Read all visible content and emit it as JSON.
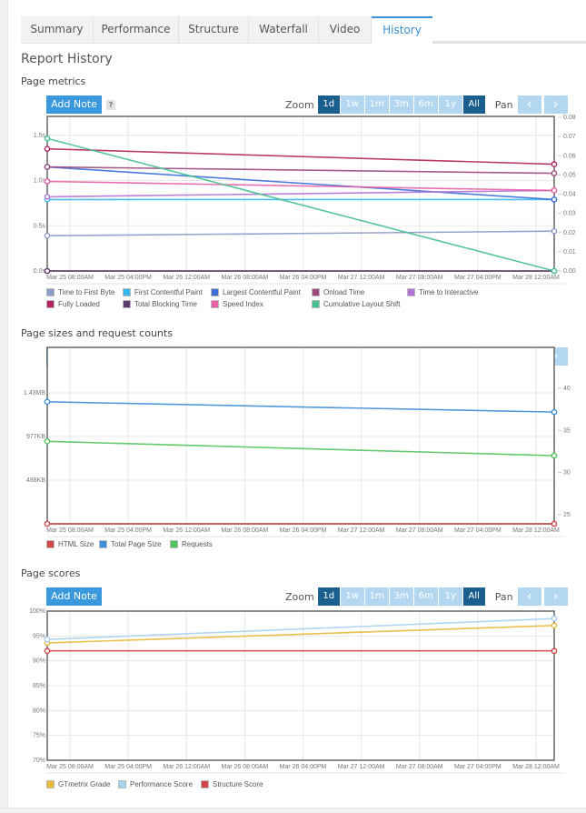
{
  "tabs": [
    {
      "label": "Summary",
      "active": false
    },
    {
      "label": "Performance",
      "active": false
    },
    {
      "label": "Structure",
      "active": false
    },
    {
      "label": "Waterfall",
      "active": false
    },
    {
      "label": "Video",
      "active": false
    },
    {
      "label": "History",
      "active": true
    }
  ],
  "page_title": "Report History",
  "controls": {
    "add_note_label": "Add Note",
    "help_label": "?",
    "zoom_label": "Zoom",
    "zoom_options": [
      {
        "label": "1d",
        "selected": true
      },
      {
        "label": "1w",
        "selected": false
      },
      {
        "label": "1m",
        "selected": false
      },
      {
        "label": "3m",
        "selected": false
      },
      {
        "label": "6m",
        "selected": false
      },
      {
        "label": "1y",
        "selected": false
      },
      {
        "label": "All",
        "selected": true
      }
    ],
    "pan_label": "Pan",
    "pan_prev_icon": "‹",
    "pan_next_icon": "›"
  },
  "chart_data": [
    {
      "type": "line",
      "title": "Page metrics",
      "x": [
        "Mar 25 08:00AM",
        "Mar 25 04:00PM",
        "Mar 26 12:00AM",
        "Mar 26 08:00AM",
        "Mar 26 04:00PM",
        "Mar 27 12:00AM",
        "Mar 27 08:00AM",
        "Mar 27 04:00PM",
        "Mar 28 12:00AM"
      ],
      "x_start_label": "Mar 25 08:00AM",
      "x_end_label": "Mar 28 12:00AM",
      "left_axis": {
        "ticks": [
          "0.0s",
          "0.5s",
          "1.0s",
          "1.5s"
        ],
        "tick_values": [
          0,
          0.5,
          1.0,
          1.5
        ],
        "range": [
          0,
          1.71
        ]
      },
      "right_axis": {
        "ticks": [
          "0.00",
          "0.01",
          "0.02",
          "0.03",
          "0.04",
          "0.05",
          "0.06",
          "0.07",
          "0.08"
        ],
        "tick_values": [
          0,
          0.01,
          0.02,
          0.03,
          0.04,
          0.05,
          0.06,
          0.07,
          0.08
        ],
        "range": [
          0,
          0.08
        ]
      },
      "grid": true,
      "legend_position": "bottom",
      "series": [
        {
          "name": "Time to First Byte",
          "color": "#8b9bc9",
          "axis": "left",
          "values": [
            0.39,
            0.44
          ]
        },
        {
          "name": "First Contentful Paint",
          "color": "#36b6ea",
          "axis": "left",
          "values": [
            0.79,
            0.79
          ]
        },
        {
          "name": "Largest Contentful Paint",
          "color": "#3a6fd8",
          "axis": "left",
          "values": [
            1.15,
            0.79
          ]
        },
        {
          "name": "Onload Time",
          "color": "#9b4a7e",
          "axis": "left",
          "values": [
            1.15,
            1.08
          ]
        },
        {
          "name": "Time to Interactive",
          "color": "#b172d6",
          "axis": "left",
          "values": [
            0.82,
            0.89
          ]
        },
        {
          "name": "Fully Loaded",
          "color": "#b2245f",
          "axis": "left",
          "values": [
            1.35,
            1.18
          ]
        },
        {
          "name": "Total Blocking Time",
          "color": "#5b3a6e",
          "axis": "left",
          "values": [
            0.0,
            0.0
          ]
        },
        {
          "name": "Speed Index",
          "color": "#e85fa5",
          "axis": "left",
          "values": [
            0.99,
            0.89
          ]
        },
        {
          "name": "Cumulative Layout Shift",
          "color": "#45c090",
          "axis": "right",
          "values": [
            0.069,
            0.0
          ]
        }
      ]
    },
    {
      "type": "line",
      "title": "Page sizes and request counts",
      "x": [
        "Mar 25 08:00AM",
        "Mar 25 04:00PM",
        "Mar 26 12:00AM",
        "Mar 26 08:00AM",
        "Mar 26 04:00PM",
        "Mar 27 12:00AM",
        "Mar 27 08:00AM",
        "Mar 27 04:00PM",
        "Mar 28 12:00AM"
      ],
      "left_axis": {
        "ticks": [
          "488KB",
          "977KB",
          "1.43MB"
        ],
        "tick_values_kb": [
          488,
          977,
          1465
        ],
        "range_kb": [
          0,
          1930
        ]
      },
      "right_axis": {
        "ticks": [
          "25",
          "30",
          "35",
          "40"
        ],
        "tick_values": [
          25,
          30,
          35,
          40
        ],
        "range": [
          24,
          42
        ]
      },
      "grid": true,
      "legend_position": "bottom",
      "series": [
        {
          "name": "HTML Size",
          "color": "#d04545",
          "axis": "left",
          "unit": "KB",
          "values": [
            0,
            0
          ]
        },
        {
          "name": "Total Page Size",
          "color": "#3d8fd6",
          "axis": "left",
          "unit": "KB",
          "values": [
            1365,
            1250
          ]
        },
        {
          "name": "Requests",
          "color": "#52c45e",
          "axis": "right",
          "unit": "count",
          "values": [
            33.7,
            32.0
          ]
        }
      ]
    },
    {
      "type": "line",
      "title": "Page scores",
      "x": [
        "Mar 25 08:00AM",
        "Mar 25 04:00PM",
        "Mar 26 12:00AM",
        "Mar 26 08:00AM",
        "Mar 26 04:00PM",
        "Mar 27 12:00AM",
        "Mar 27 08:00AM",
        "Mar 27 04:00PM",
        "Mar 28 12:00AM"
      ],
      "left_axis": {
        "ticks": [
          "70%",
          "75%",
          "80%",
          "85%",
          "90%",
          "95%",
          "100%"
        ],
        "tick_values": [
          70,
          75,
          80,
          85,
          90,
          95,
          100
        ],
        "range": [
          70,
          100
        ]
      },
      "grid": true,
      "legend_position": "bottom",
      "series": [
        {
          "name": "GTmetrix Grade",
          "color": "#e8b93a",
          "values": [
            93.6,
            97.1
          ]
        },
        {
          "name": "Performance Score",
          "color": "#a9d1f0",
          "values": [
            94.3,
            98.5
          ]
        },
        {
          "name": "Structure Score",
          "color": "#d04545",
          "values": [
            92.0,
            92.0
          ]
        }
      ]
    }
  ]
}
